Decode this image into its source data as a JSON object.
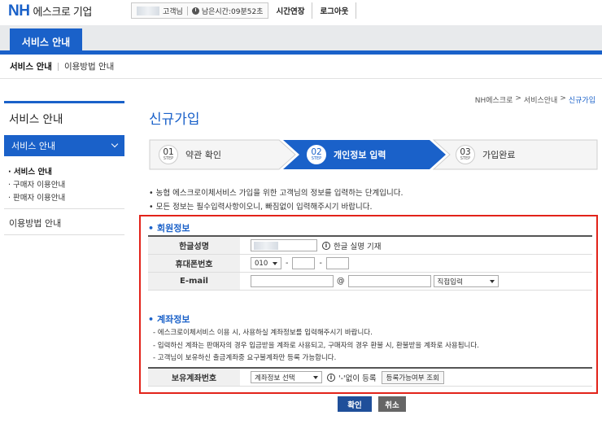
{
  "header": {
    "logo_brand": "NH",
    "logo_text": "에스크로 기업",
    "user_name": "고객님",
    "remaining_time": "남은시간:09분52초",
    "extend_button": "시간연장",
    "logout_button": "로그아웃"
  },
  "nav": {
    "main_tab": "서비스 안내",
    "sub_items": [
      "서비스 안내",
      "이용방법 안내"
    ]
  },
  "sidebar": {
    "title": "서비스 안내",
    "active_item": "서비스 안내",
    "sub_items": [
      "· 서비스 안내",
      "· 구매자 이용안내",
      "· 판매자 이용안내"
    ],
    "item2": "이용방법 안내"
  },
  "breadcrumb": [
    "NH에스크로",
    "서비스안내",
    "신규가입"
  ],
  "page_title": "신규가입",
  "steps": [
    {
      "num": "01",
      "step": "STEP",
      "label": "약관 확인"
    },
    {
      "num": "02",
      "step": "STEP",
      "label": "개인정보 입력"
    },
    {
      "num": "03",
      "step": "STEP",
      "label": "가입완료"
    }
  ],
  "notes": [
    "농협 에스크로이체서비스 가입을 위한 고객님의 정보를 입력하는 단계입니다.",
    "모든 정보는 필수입력사항이오니, 빠짐없이 입력해주시기 바랍니다."
  ],
  "member": {
    "title": "회원정보",
    "name_label": "한글성명",
    "name_hint": "한글 실명 기재",
    "phone_label": "휴대폰번호",
    "phone_prefix": "010",
    "email_label": "E-mail",
    "email_at": "@",
    "email_domain_select": "직접입력"
  },
  "account": {
    "title": "계좌정보",
    "notes": [
      "- 에스크로이체서비스 이용 시, 사용하실 계좌정보를 입력해주시기 바랍니다.",
      "- 입력하신 계좌는 판매자의 경우 입금받을 계좌로 사용되고, 구매자의 경우 환불 시, 환불받을 계좌로 사용됩니다.",
      "- 고객님이 보유하신 출금계좌중 요구불계좌만 등록 가능합니다."
    ],
    "label": "보유계좌번호",
    "select": "계좌정보 선택",
    "hint": "'-'없이 등록",
    "check_button": "등록가능여부 조회"
  },
  "actions": {
    "confirm": "확인",
    "cancel": "취소"
  },
  "colors": {
    "brand_blue": "#1a61c9",
    "highlight_red": "#e2231a"
  }
}
